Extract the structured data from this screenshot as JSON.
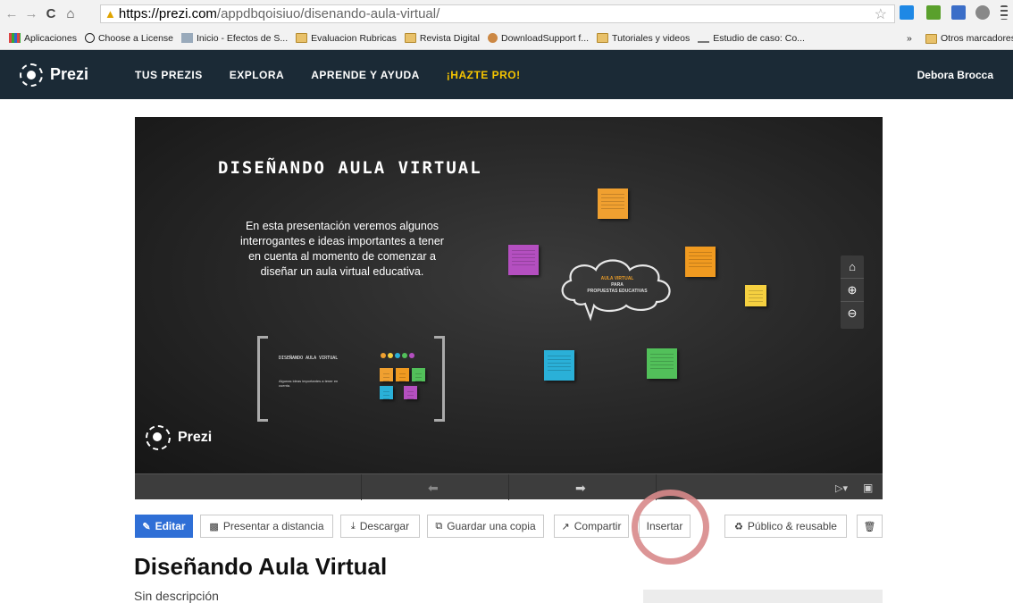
{
  "browser": {
    "url_host": "https://prezi.com",
    "url_path": "/appdbqoisiuo/disenando-aula-virtual/",
    "bookmarks": [
      {
        "label": "Aplicaciones",
        "type": "apps"
      },
      {
        "label": "Choose a License",
        "type": "cc"
      },
      {
        "label": "Inicio - Efectos de S...",
        "type": "page"
      },
      {
        "label": "Evaluacion Rubricas",
        "type": "folder"
      },
      {
        "label": "Revista Digital",
        "type": "folder"
      },
      {
        "label": "DownloadSupport f...",
        "type": "page"
      },
      {
        "label": "Tutoriales y videos",
        "type": "folder"
      },
      {
        "label": "Estudio de caso: Co...",
        "type": "page"
      }
    ],
    "overflow": "»",
    "other_bookmarks": "Otros marcadores"
  },
  "header": {
    "logo": "Prezi",
    "nav": [
      "TUS PREZIS",
      "EXPLORA",
      "APRENDE Y AYUDA",
      "¡HAZTE PRO!"
    ],
    "user": "Debora Brocca"
  },
  "presentation": {
    "title": "DISEÑANDO AULA VIRTUAL",
    "intro": "En esta presentación veremos algunos interrogantes e ideas importantes a tener en cuenta al momento de comenzar a diseñar un aula virtual educativa.",
    "cloud_line1": "AULA VIRTUAL",
    "cloud_line2": "PARA",
    "cloud_line3": "PROPUESTAS EDUCATIVAS",
    "mini_title": "DISEÑANDO AULA VIRTUAL",
    "mini_desc": "Algunas ideas importantes a tener en cuenta.",
    "logo": "Prezi"
  },
  "actions": {
    "edit": "Editar",
    "present_remote": "Presentar a distancia",
    "download": "Descargar",
    "save_copy": "Guardar una copia",
    "share": "Compartir",
    "embed": "Insertar",
    "public": "Público & reusable"
  },
  "document": {
    "title": "Diseñando Aula Virtual",
    "description": "Sin descripción"
  },
  "colors": {
    "nav_bg": "#1b2a36",
    "pro": "#f5c400",
    "edit_btn": "#2f6fd6",
    "annotation": "#d8898b"
  }
}
